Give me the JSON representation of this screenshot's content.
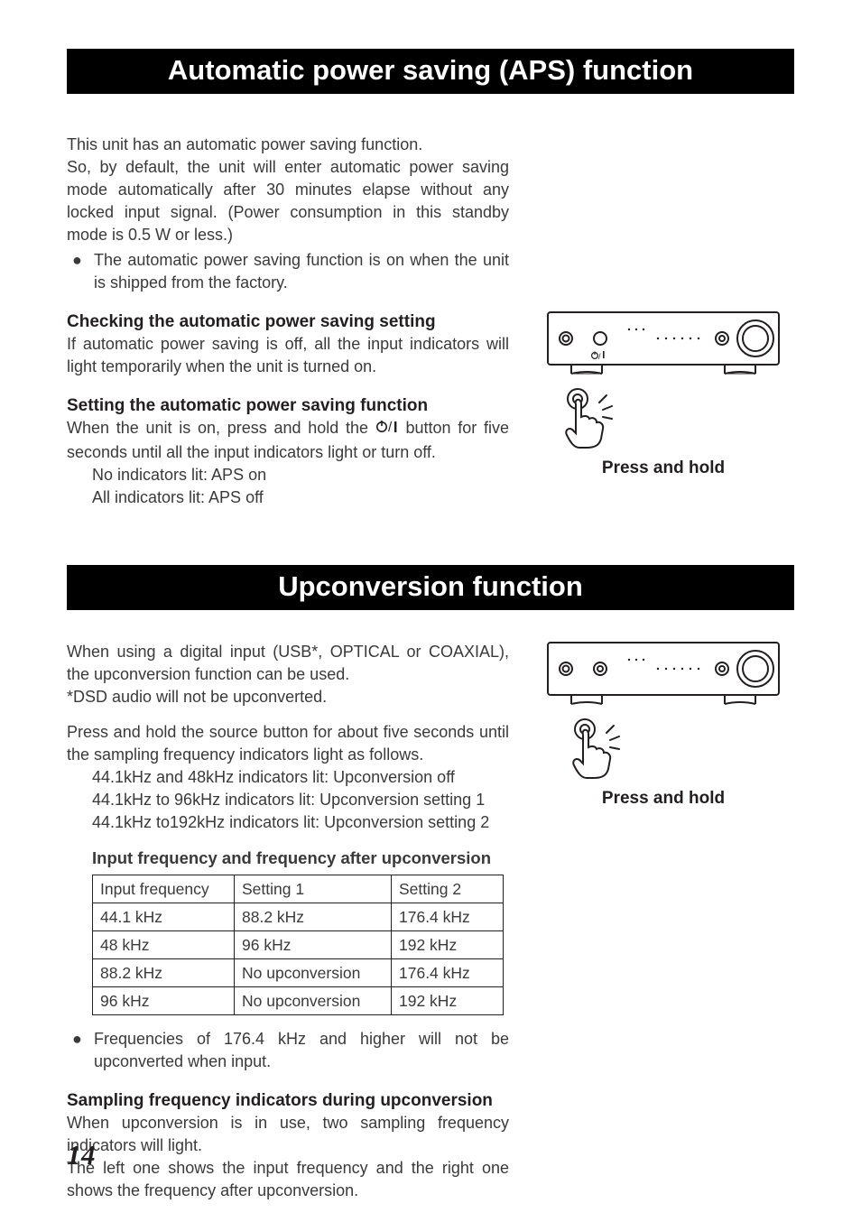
{
  "page_number": "14",
  "aps": {
    "title": "Automatic power saving (APS) function",
    "intro_line1": "This unit has an automatic power saving function.",
    "intro_block": "So, by default, the unit will enter automatic power saving mode automatically after 30 minutes elapse without any locked input signal. (Power consumption in this standby mode is 0.5 W or less.)",
    "bullet1": "The automatic power saving function is on when the unit is shipped from the factory.",
    "check_heading": "Checking the automatic power saving setting",
    "check_body": "If automatic power saving is off, all the input indicators will light temporarily when the unit is turned on.",
    "set_heading": "Setting the automatic power saving function",
    "set_body_pre": "When the unit is on, press and hold the ",
    "set_body_post": " button for five seconds until all the input indicators light or turn off.",
    "state_on": "No indicators lit: APS on",
    "state_off": "All indicators lit: APS off",
    "caption": "Press and hold"
  },
  "up": {
    "title": "Upconversion function",
    "intro": "When using a digital input (USB*, OPTICAL or COAXIAL), the upconversion function can be used.",
    "dsd_note": "*DSD audio will not be upconverted.",
    "instruction": "Press and hold the source button for about five seconds until the sampling frequency indicators light as follows.",
    "opt_off": "44.1kHz and 48kHz indicators lit: Upconversion off",
    "opt_s1": "44.1kHz to 96kHz indicators lit: Upconversion setting 1",
    "opt_s2": "44.1kHz to192kHz indicators lit: Upconversion setting 2",
    "table_title": "Input frequency and frequency after upconversion",
    "table": {
      "headers": [
        "Input frequency",
        "Setting 1",
        "Setting 2"
      ],
      "rows": [
        [
          "44.1 kHz",
          "88.2 kHz",
          "176.4 kHz"
        ],
        [
          "48 kHz",
          "96 kHz",
          "192 kHz"
        ],
        [
          "88.2 kHz",
          "No upconversion",
          "176.4 kHz"
        ],
        [
          "96 kHz",
          "No upconversion",
          "192 kHz"
        ]
      ]
    },
    "bullet1": "Frequencies of 176.4 kHz and higher will not be upconverted when input.",
    "samp_heading": "Sampling frequency indicators during upconversion",
    "samp_body1": "When upconversion is in use, two sampling frequency indicators will light.",
    "samp_body2": "The left one shows the input frequency and the right one shows the frequency after upconversion.",
    "caption": "Press and hold"
  }
}
